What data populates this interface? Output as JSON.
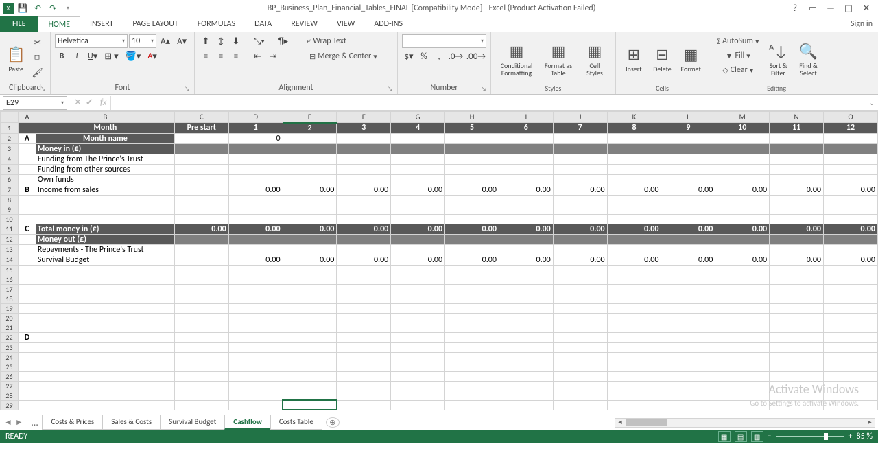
{
  "titlebar": {
    "title": "BP_Business_Plan_Financial_Tables_FINAL  [Compatibility Mode] - Excel (Product Activation Failed)"
  },
  "ribbonTabs": {
    "file": "FILE",
    "tabs": [
      "HOME",
      "INSERT",
      "PAGE LAYOUT",
      "FORMULAS",
      "DATA",
      "REVIEW",
      "VIEW",
      "ADD-INS"
    ],
    "active": "HOME",
    "signin": "Sign in"
  },
  "ribbon": {
    "clipboard": {
      "paste": "Paste",
      "label": "Clipboard"
    },
    "font": {
      "name": "Helvetica",
      "size": "10",
      "label": "Font"
    },
    "alignment": {
      "wrap": "Wrap Text",
      "merge": "Merge & Center",
      "label": "Alignment"
    },
    "number": {
      "label": "Number"
    },
    "styles": {
      "cond": "Conditional Formatting",
      "fat": "Format as Table",
      "cell": "Cell Styles",
      "label": "Styles"
    },
    "cells": {
      "insert": "Insert",
      "delete": "Delete",
      "format": "Format",
      "label": "Cells"
    },
    "editing": {
      "autosum": "AutoSum",
      "fill": "Fill",
      "clear": "Clear",
      "sort": "Sort & Filter",
      "find": "Find & Select",
      "label": "Editing"
    }
  },
  "namebox": "E29",
  "columns": [
    "A",
    "B",
    "C",
    "D",
    "E",
    "F",
    "G",
    "H",
    "I",
    "J",
    "K",
    "L",
    "M",
    "N",
    "O"
  ],
  "rows": {
    "1": {
      "A": "",
      "B": "Month",
      "C": "Pre start",
      "D": "1",
      "E": "2",
      "F": "3",
      "G": "4",
      "H": "5",
      "I": "6",
      "J": "7",
      "K": "8",
      "L": "9",
      "M": "10",
      "N": "11",
      "O": "12"
    },
    "2": {
      "A": "A",
      "B": "Month name",
      "C": "",
      "D": "0"
    },
    "3": {
      "A": "",
      "B": "Money in (£)"
    },
    "4": {
      "A": "",
      "B": "Funding from The Prince's Trust"
    },
    "5": {
      "A": "",
      "B": "Funding from other sources"
    },
    "6": {
      "A": "",
      "B": "Own funds"
    },
    "7": {
      "A": "B",
      "B": "Income from sales",
      "D": "0.00",
      "E": "0.00",
      "F": "0.00",
      "G": "0.00",
      "H": "0.00",
      "I": "0.00",
      "J": "0.00",
      "K": "0.00",
      "L": "0.00",
      "M": "0.00",
      "N": "0.00",
      "O": "0.00"
    },
    "8": {},
    "9": {},
    "10": {},
    "11": {
      "A": "C",
      "B": "Total money in (£)",
      "C": "0.00",
      "D": "0.00",
      "E": "0.00",
      "F": "0.00",
      "G": "0.00",
      "H": "0.00",
      "I": "0.00",
      "J": "0.00",
      "K": "0.00",
      "L": "0.00",
      "M": "0.00",
      "N": "0.00",
      "O": "0.00"
    },
    "12": {
      "A": "",
      "B": "Money out (£)"
    },
    "13": {
      "A": "",
      "B": "Repayments - The Prince's Trust"
    },
    "14": {
      "A": "",
      "B": "Survival Budget",
      "D": "0.00",
      "E": "0.00",
      "F": "0.00",
      "G": "0.00",
      "H": "0.00",
      "I": "0.00",
      "J": "0.00",
      "K": "0.00",
      "L": "0.00",
      "M": "0.00",
      "N": "0.00",
      "O": "0.00"
    },
    "15": {},
    "16": {},
    "17": {},
    "18": {},
    "19": {},
    "20": {},
    "21": {},
    "22": {
      "A": "D"
    },
    "23": {},
    "24": {},
    "25": {},
    "26": {},
    "27": {},
    "28": {},
    "29": {}
  },
  "sheets": {
    "list": [
      "Costs & Prices",
      "Sales & Costs",
      "Survival Budget",
      "Cashflow",
      "Costs Table"
    ],
    "active": "Cashflow"
  },
  "status": {
    "ready": "READY",
    "zoom": "85 %"
  },
  "watermark": {
    "line1": "Activate Windows",
    "line2": "Go to Settings to activate Windows."
  }
}
